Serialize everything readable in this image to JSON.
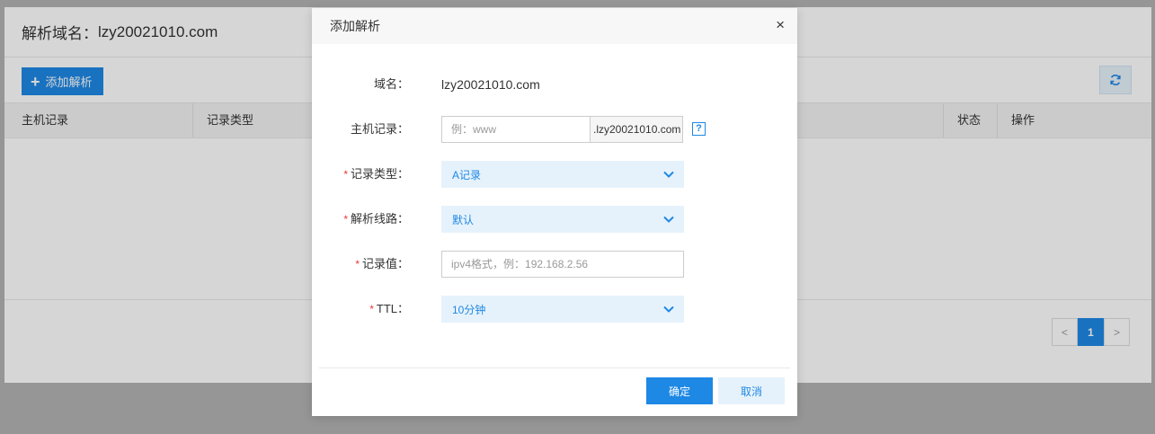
{
  "page": {
    "title_prefix": "解析域名：",
    "domain": "lzy20021010.com",
    "add_button_label": "添加解析",
    "add_icon": "plus-icon",
    "refresh_icon": "refresh-icon",
    "columns": [
      "主机记录",
      "记录类型",
      "状态",
      "操作"
    ],
    "pager": {
      "prev": "<",
      "current": "1",
      "next": ">"
    }
  },
  "modal": {
    "title": "添加解析",
    "close_label": "×",
    "fields": {
      "domain": {
        "label": "域名：",
        "value": "lzy20021010.com"
      },
      "host": {
        "label": "主机记录：",
        "placeholder": "例：www",
        "suffix": ".lzy20021010.com",
        "help": "?"
      },
      "record_type": {
        "required_mark": "*",
        "label": "记录类型：",
        "value": "A记录"
      },
      "line": {
        "required_mark": "*",
        "label": "解析线路：",
        "value": "默认"
      },
      "record_value": {
        "required_mark": "*",
        "label": "记录值：",
        "placeholder": "ipv4格式，例：192.168.2.56"
      },
      "ttl": {
        "required_mark": "*",
        "label": "TTL：",
        "value": "10分钟"
      }
    },
    "ok_label": "确定",
    "cancel_label": "取消"
  },
  "colors": {
    "accent": "#1e88e5",
    "select_bg": "#e6f2fb",
    "required": "#e53935"
  }
}
